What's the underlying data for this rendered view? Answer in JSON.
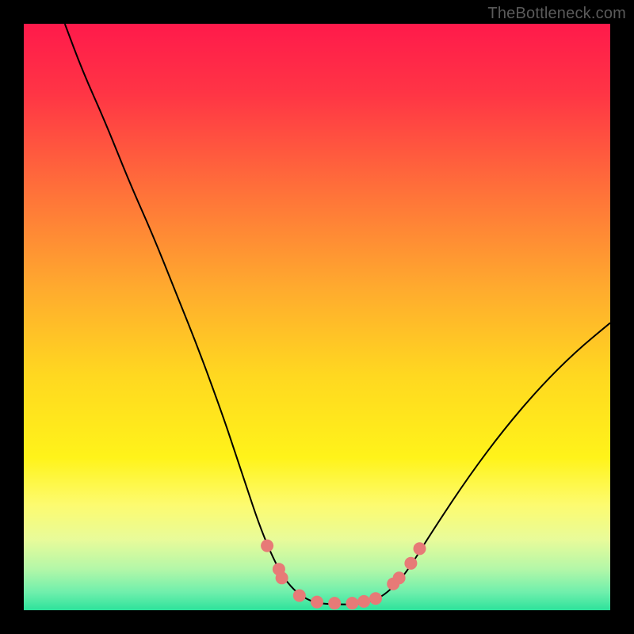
{
  "watermark": "TheBottleneck.com",
  "chart_data": {
    "type": "line",
    "title": "",
    "xlabel": "",
    "ylabel": "",
    "xlim": [
      0,
      100
    ],
    "ylim": [
      0,
      100
    ],
    "grid": false,
    "legend": false,
    "annotations": [],
    "background_gradient": {
      "direction": "vertical",
      "stops": [
        {
          "pos": 0.0,
          "color": "#ff1a4b"
        },
        {
          "pos": 0.12,
          "color": "#ff3545"
        },
        {
          "pos": 0.28,
          "color": "#ff6f3a"
        },
        {
          "pos": 0.45,
          "color": "#ffaa2e"
        },
        {
          "pos": 0.6,
          "color": "#ffd820"
        },
        {
          "pos": 0.74,
          "color": "#fff31a"
        },
        {
          "pos": 0.82,
          "color": "#fdfb6f"
        },
        {
          "pos": 0.88,
          "color": "#e8fb9a"
        },
        {
          "pos": 0.93,
          "color": "#b3f7a8"
        },
        {
          "pos": 0.97,
          "color": "#6eefac"
        },
        {
          "pos": 1.0,
          "color": "#2de29b"
        }
      ]
    },
    "series": [
      {
        "name": "bottleneck-curve",
        "color": "#000000",
        "stroke_width": 2,
        "x": [
          7,
          10,
          14,
          18,
          22,
          26,
          30,
          34,
          36,
          38,
          40,
          42,
          44,
          46,
          48,
          50,
          53,
          56,
          58,
          60,
          62,
          65,
          70,
          76,
          82,
          88,
          94,
          100
        ],
        "y": [
          100,
          92,
          83,
          73,
          64,
          54,
          44,
          33,
          27,
          21,
          15,
          10,
          6,
          3.5,
          2,
          1.2,
          1,
          1,
          1.2,
          1.8,
          3,
          6,
          14,
          23,
          31,
          38,
          44,
          49
        ]
      }
    ],
    "markers": {
      "name": "highlight-dots",
      "color": "#e77a77",
      "radius": 8,
      "points": [
        {
          "x": 41.5,
          "y": 11
        },
        {
          "x": 43.5,
          "y": 7
        },
        {
          "x": 44,
          "y": 5.5
        },
        {
          "x": 47,
          "y": 2.5
        },
        {
          "x": 50,
          "y": 1.4
        },
        {
          "x": 53,
          "y": 1.2
        },
        {
          "x": 56,
          "y": 1.2
        },
        {
          "x": 58,
          "y": 1.5
        },
        {
          "x": 60,
          "y": 2
        },
        {
          "x": 63,
          "y": 4.5
        },
        {
          "x": 64,
          "y": 5.5
        },
        {
          "x": 66,
          "y": 8
        },
        {
          "x": 67.5,
          "y": 10.5
        }
      ]
    }
  }
}
